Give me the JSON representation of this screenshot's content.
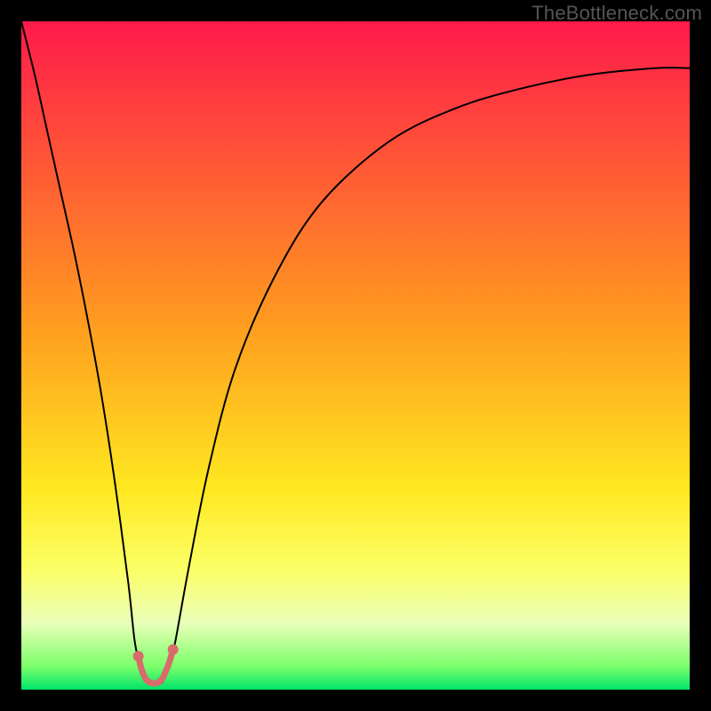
{
  "watermark": "TheBottleneck.com",
  "chart_data": {
    "type": "line",
    "title": "",
    "xlabel": "",
    "ylabel": "",
    "xlim": [
      0,
      100
    ],
    "ylim": [
      0,
      100
    ],
    "grid": false,
    "background_gradient": {
      "stops": [
        {
          "offset": 0.0,
          "color": "#ff1a4b"
        },
        {
          "offset": 0.45,
          "color": "#ff9b1f"
        },
        {
          "offset": 0.7,
          "color": "#ffe820"
        },
        {
          "offset": 0.82,
          "color": "#fbff66"
        },
        {
          "offset": 0.9,
          "color": "#eaffb8"
        },
        {
          "offset": 0.965,
          "color": "#7cff6a"
        },
        {
          "offset": 1.0,
          "color": "#00e46a"
        }
      ]
    },
    "series": [
      {
        "name": "bottleneck-curve",
        "type": "line",
        "color": "#000000",
        "x": [
          0,
          2,
          4,
          6,
          8,
          10,
          12,
          14,
          16,
          17,
          18,
          19,
          20,
          21,
          22,
          23,
          25,
          28,
          32,
          38,
          45,
          55,
          65,
          75,
          85,
          95,
          100
        ],
        "y": [
          100,
          92,
          83,
          74,
          65,
          55,
          44,
          31,
          16,
          7,
          3,
          1,
          1,
          1,
          3,
          7,
          18,
          33,
          48,
          62,
          73,
          82,
          87,
          90,
          92,
          93,
          93
        ]
      },
      {
        "name": "valley-highlight",
        "type": "line",
        "color": "#d86b6b",
        "stroke_width": 7,
        "x": [
          17.5,
          18,
          18.7,
          19.5,
          20.3,
          21,
          21.5,
          22.1,
          22.7
        ],
        "y": [
          5.0,
          3.0,
          1.5,
          1.0,
          1.0,
          1.5,
          2.5,
          4.0,
          6.0
        ]
      }
    ],
    "valley_dots": {
      "color": "#d86b6b",
      "radius": 6,
      "points": [
        {
          "x": 17.5,
          "y": 5.0
        },
        {
          "x": 22.7,
          "y": 6.0
        }
      ]
    }
  }
}
